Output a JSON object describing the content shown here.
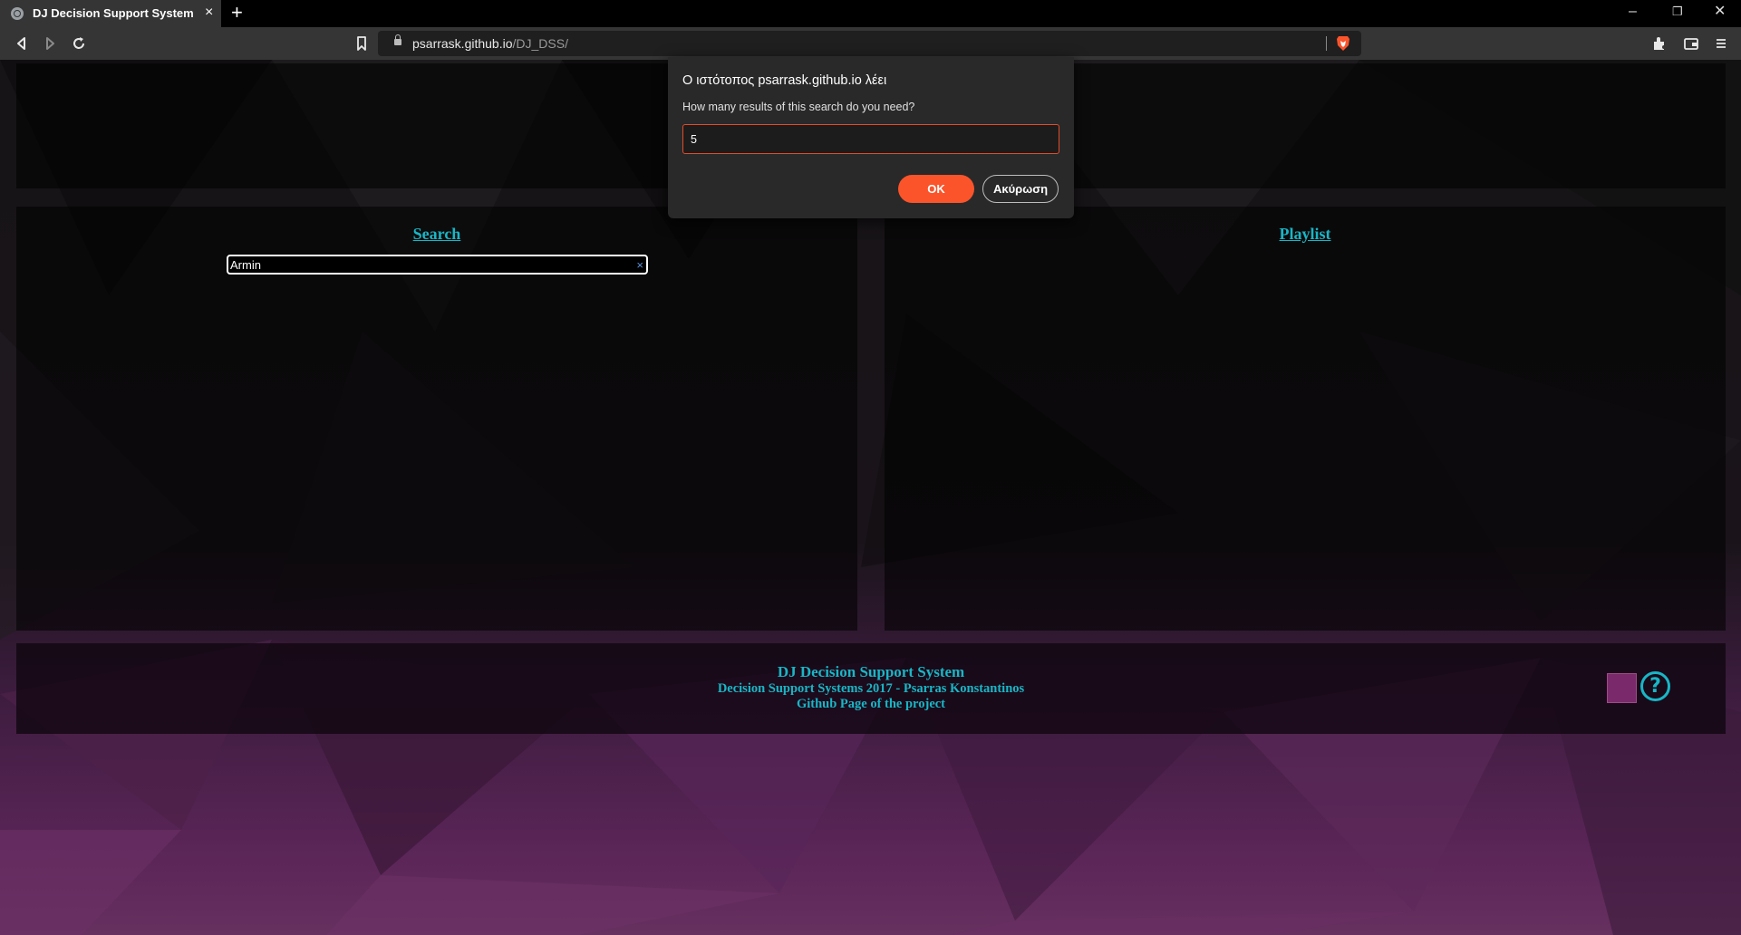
{
  "browser": {
    "tab_title": "DJ Decision Support System",
    "tab_close": "×",
    "new_tab": "+",
    "url_host": "psarrask.github.io",
    "url_path": "/DJ_DSS/",
    "window_controls": {
      "minimize": "–",
      "restore": "❐",
      "close": "✕"
    }
  },
  "search": {
    "heading": "Search",
    "input_value": "Armin",
    "clear_icon": "×"
  },
  "playlist": {
    "heading": "Playlist"
  },
  "footer": {
    "title": "DJ Decision Support System",
    "subtitle": "Decision Support Systems 2017 - Psarras Konstantinos",
    "link": "Github Page of the project",
    "help_glyph": "?",
    "swatch_color": "#7a2a6a"
  },
  "dialog": {
    "title": "Ο ιστότοπος psarrask.github.io λέει",
    "message": "How many results of this search do you need?",
    "input_value": "5",
    "ok_label": "OK",
    "cancel_label": "Ακύρωση"
  },
  "colors": {
    "accent": "#18b6c6",
    "brave_orange": "#fb542b"
  }
}
